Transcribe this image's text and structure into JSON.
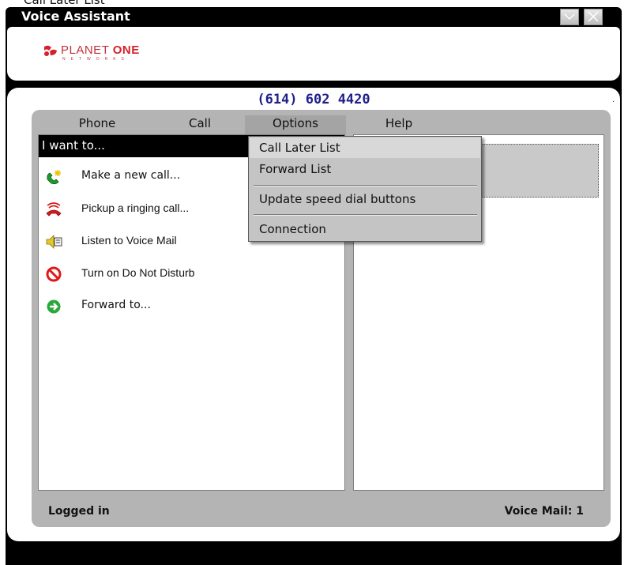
{
  "cut_off_text": "Call Later List",
  "window": {
    "title": "Voice Assistant"
  },
  "logo": {
    "planet": "PLANET",
    "one": "ONE",
    "sub": "NETWORKS"
  },
  "phone_number": "(614) 602 4420",
  "corner_mark": ".",
  "menu": {
    "phone": "Phone",
    "call": "Call",
    "options": "Options",
    "help": "Help"
  },
  "options_dropdown": {
    "call_later_list": "Call Later List",
    "forward_list": "Forward List",
    "update_speed_dial": "Update speed dial buttons",
    "connection": "Connection"
  },
  "left_pane": {
    "header": "I want to...",
    "actions": [
      {
        "label": "Make a new call...",
        "icon": "phone-new-call-icon"
      },
      {
        "label": "Pickup a ringing call...",
        "icon": "ringing-phone-icon"
      },
      {
        "label": "Listen to Voice Mail",
        "icon": "voicemail-speaker-icon"
      },
      {
        "label": "Turn on Do Not Disturb",
        "icon": "do-not-disturb-icon"
      },
      {
        "label": "Forward to...",
        "icon": "forward-arrow-icon"
      }
    ]
  },
  "status": {
    "left": "Logged in",
    "right": "Voice Mail: 1"
  },
  "colors": {
    "titlebar": "#000000",
    "phone_number": "#1f1f8c",
    "frame": "#b4b4b4",
    "brand_red": "#d8202b"
  }
}
